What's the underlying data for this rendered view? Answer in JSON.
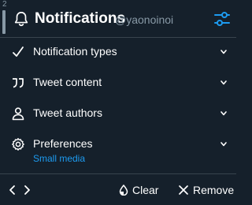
{
  "header": {
    "column_index": "2",
    "title": "Notifications",
    "handle": "@yaonoinoi",
    "accent_color": "#1d9bf0"
  },
  "sections": [
    {
      "label": "Notification types",
      "icon": "check-icon"
    },
    {
      "label": "Tweet content",
      "icon": "quote-icon"
    },
    {
      "label": "Tweet authors",
      "icon": "user-icon"
    },
    {
      "label": "Preferences",
      "icon": "gear-icon"
    }
  ],
  "preferences_sub": "Small media",
  "footer": {
    "clear_label": "Clear",
    "remove_label": "Remove"
  }
}
